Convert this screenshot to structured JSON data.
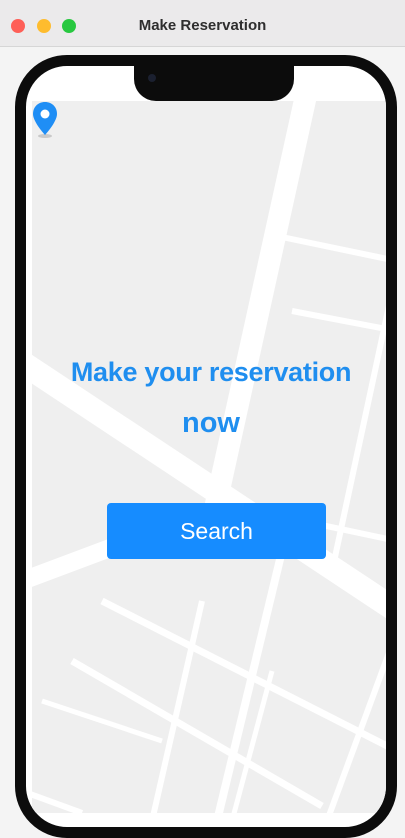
{
  "window": {
    "title": "Make Reservation"
  },
  "main": {
    "headline_line1": "Make your reservation",
    "headline_line2": "now",
    "search_label": "Search"
  },
  "icons": {
    "location": "location-pin-icon",
    "camera": "front-camera-icon"
  },
  "colors": {
    "accent": "#168cff",
    "headline": "#1f8eef",
    "map_background": "#efefef",
    "map_roads": "#ffffff",
    "phone_bezel": "#0c0c0c"
  }
}
